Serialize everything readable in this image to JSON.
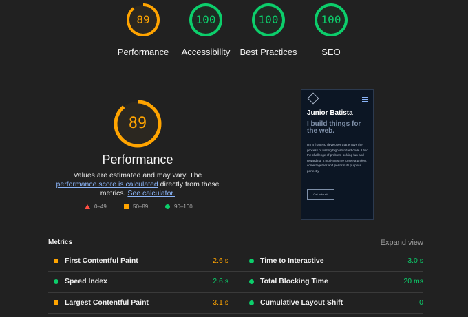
{
  "colors": {
    "orange": "#ffa400",
    "green": "#0cce6b",
    "red": "#ff4e42",
    "link": "#8ab4f8"
  },
  "gauges": [
    {
      "score": 89,
      "fraction": 0.89,
      "label": "Performance",
      "color": "#ffa400"
    },
    {
      "score": 100,
      "fraction": 1.0,
      "label": "Accessibility",
      "color": "#0cce6b"
    },
    {
      "score": 100,
      "fraction": 1.0,
      "label": "Best Practices",
      "color": "#0cce6b"
    },
    {
      "score": 100,
      "fraction": 1.0,
      "label": "SEO",
      "color": "#0cce6b"
    }
  ],
  "performance": {
    "score": 89,
    "fraction": 0.89,
    "title": "Performance",
    "desc_prefix": "Values are estimated and may vary. The ",
    "link1": "performance score is calculated",
    "desc_mid": " directly from these metrics. ",
    "link2": "See calculator."
  },
  "legend": {
    "fail": "0–49",
    "average": "50–89",
    "pass": "90–100"
  },
  "preview": {
    "name": "Junior Batista",
    "tagline": "I build things for the web.",
    "body": "I'm a frontend developer that enjoys the process of writing high-standard code. I find the challenge of problem-solving fun and rewarding. It motivates me to see a project come together and perform its purpose perfectly.",
    "cta": "Get in touch"
  },
  "metrics": {
    "title": "Metrics",
    "expand_label": "Expand view",
    "left": [
      {
        "name": "First Contentful Paint",
        "value": "2.6 s",
        "status": "average"
      },
      {
        "name": "Speed Index",
        "value": "2.6 s",
        "status": "pass"
      },
      {
        "name": "Largest Contentful Paint",
        "value": "3.1 s",
        "status": "average"
      }
    ],
    "right": [
      {
        "name": "Time to Interactive",
        "value": "3.0 s",
        "status": "pass"
      },
      {
        "name": "Total Blocking Time",
        "value": "20 ms",
        "status": "pass"
      },
      {
        "name": "Cumulative Layout Shift",
        "value": "0",
        "status": "pass"
      }
    ]
  }
}
